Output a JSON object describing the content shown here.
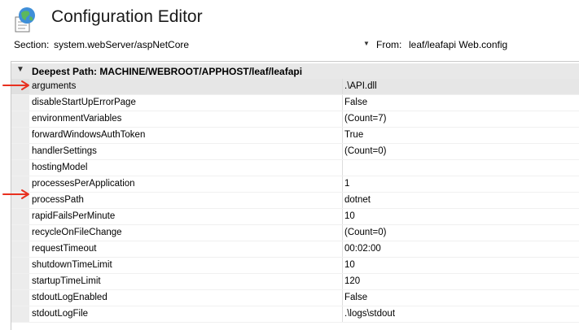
{
  "header": {
    "title": "Configuration Editor"
  },
  "section": {
    "label": "Section:",
    "value": "system.webServer/aspNetCore"
  },
  "from": {
    "label": "From:",
    "value": "leaf/leafapi Web.config"
  },
  "group": {
    "title": "Deepest Path: MACHINE/WEBROOT/APPHOST/leaf/leafapi"
  },
  "rows": [
    {
      "name": "arguments",
      "value": ".\\API.dll"
    },
    {
      "name": "disableStartUpErrorPage",
      "value": "False"
    },
    {
      "name": "environmentVariables",
      "value": "(Count=7)"
    },
    {
      "name": "forwardWindowsAuthToken",
      "value": "True"
    },
    {
      "name": "handlerSettings",
      "value": "(Count=0)"
    },
    {
      "name": "hostingModel",
      "value": ""
    },
    {
      "name": "processesPerApplication",
      "value": "1"
    },
    {
      "name": "processPath",
      "value": "dotnet"
    },
    {
      "name": "rapidFailsPerMinute",
      "value": "10"
    },
    {
      "name": "recycleOnFileChange",
      "value": "(Count=0)"
    },
    {
      "name": "requestTimeout",
      "value": "00:02:00"
    },
    {
      "name": "shutdownTimeLimit",
      "value": "10"
    },
    {
      "name": "startupTimeLimit",
      "value": "120"
    },
    {
      "name": "stdoutLogEnabled",
      "value": "False"
    },
    {
      "name": "stdoutLogFile",
      "value": ".\\logs\\stdout"
    }
  ],
  "annotation_color": "#e8301f"
}
